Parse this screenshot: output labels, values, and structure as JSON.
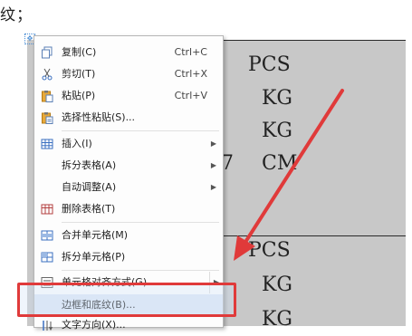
{
  "instruction_text": "纹；",
  "table": {
    "row_number": "7",
    "units": [
      "PCS",
      "KG",
      "KG",
      "CM",
      "PCS",
      "KG",
      "KG"
    ]
  },
  "context_menu": {
    "items": [
      {
        "label": "复制(C)",
        "shortcut": "Ctrl+C",
        "icon": "copy-icon"
      },
      {
        "label": "剪切(T)",
        "shortcut": "Ctrl+X",
        "icon": "scissors-icon"
      },
      {
        "label": "粘贴(P)",
        "shortcut": "Ctrl+V",
        "icon": "paste-icon"
      },
      {
        "label": "选择性粘贴(S)...",
        "shortcut": "",
        "icon": "paste-special-icon"
      },
      {
        "label": "插入(I)",
        "shortcut": "",
        "icon": "insert-table-icon",
        "submenu": true
      },
      {
        "label": "拆分表格(A)",
        "shortcut": "",
        "icon": "",
        "submenu": true
      },
      {
        "label": "自动调整(A)",
        "shortcut": "",
        "icon": "",
        "submenu": true
      },
      {
        "label": "删除表格(T)",
        "shortcut": "",
        "icon": "delete-table-icon"
      },
      {
        "label": "合并单元格(M)",
        "shortcut": "",
        "icon": "merge-cells-icon"
      },
      {
        "label": "拆分单元格(P)",
        "shortcut": "",
        "icon": "split-cells-icon"
      },
      {
        "label": "单元格对齐方式(G)",
        "shortcut": "",
        "icon": "cell-align-icon",
        "submenu": true
      },
      {
        "label": "边框和底纹(B)...",
        "shortcut": "",
        "icon": ""
      },
      {
        "label": "文字方向(X)...",
        "shortcut": "",
        "icon": "text-direction-icon"
      }
    ]
  },
  "colors": {
    "highlight_border": "#e03a3a",
    "arrow": "#e03a3a",
    "table_fill": "#c8c8c8"
  }
}
